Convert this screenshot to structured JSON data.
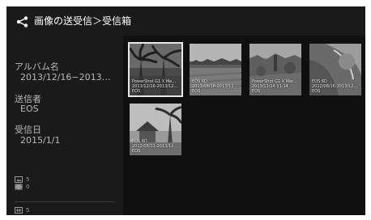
{
  "header": {
    "title": "画像の送受信＞受信箱"
  },
  "details": {
    "album_label": "アルバム名",
    "album_value": "2013/12/16−2013…",
    "sender_label": "送信者",
    "sender_value": "EOS",
    "date_label": "受信日",
    "date_value": "2015/1/1"
  },
  "counts": {
    "images": "5",
    "movies": "0",
    "storage": "5"
  },
  "thumbnails": [
    {
      "model": "PowerShot G1 X Ma…",
      "date": "2013/12/16-2013/12…",
      "sender": "EOS",
      "icon": "palm-photo"
    },
    {
      "model": "EOS 6D",
      "date": "2013/08/18-2013/12…",
      "sender": "EOS",
      "icon": "field-photo"
    },
    {
      "model": "PowerShot G1 X Mar…",
      "date": "2013/11/14 11:14",
      "sender": "EOS",
      "icon": "ruins-photo"
    },
    {
      "model": "EOS 6D",
      "date": "2012/08/16-2013/12…",
      "sender": "EOS",
      "icon": "leaf-photo"
    },
    {
      "model": "EOS 6D",
      "date": "2012/08/11-2013/12…",
      "sender": "EOS",
      "icon": "hut-photo"
    }
  ]
}
